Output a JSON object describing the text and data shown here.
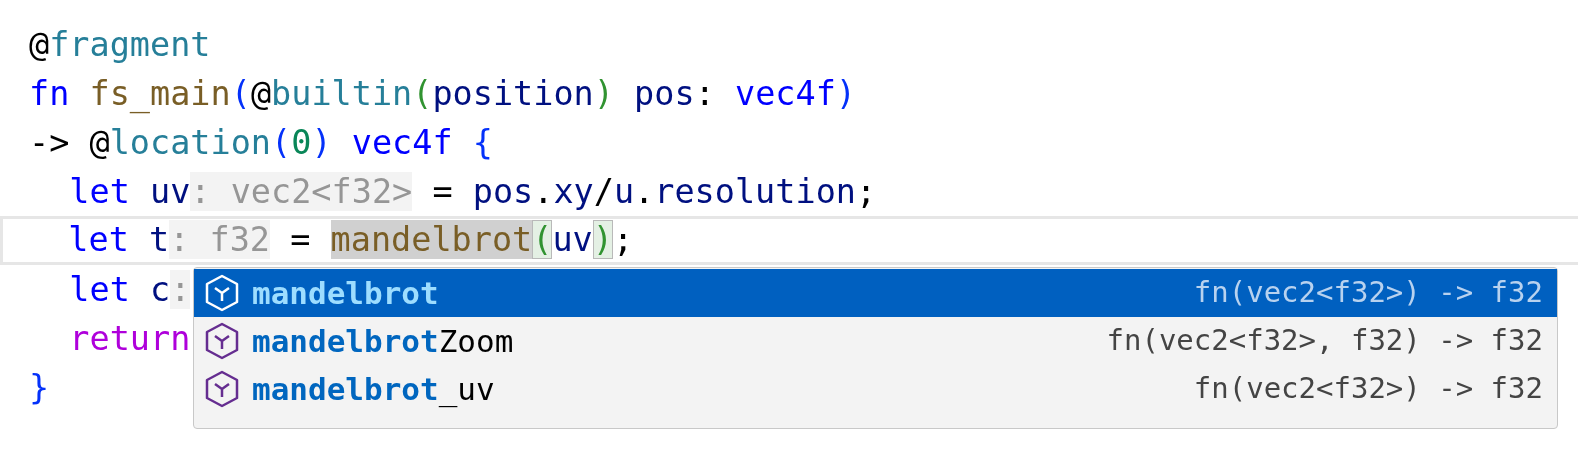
{
  "editor": {
    "lines": [
      {
        "current": false,
        "tokens": [
          {
            "text": "@",
            "kind": "plain"
          },
          {
            "text": "fragment",
            "kind": "attribute"
          }
        ]
      },
      {
        "current": false,
        "tokens": [
          {
            "text": "fn ",
            "kind": "keyword"
          },
          {
            "text": "fs_main",
            "kind": "function"
          },
          {
            "text": "(",
            "kind": "paren"
          },
          {
            "text": "@",
            "kind": "plain"
          },
          {
            "text": "builtin",
            "kind": "attribute"
          },
          {
            "text": "(",
            "kind": "paren2"
          },
          {
            "text": "position",
            "kind": "variable"
          },
          {
            "text": ") ",
            "kind": "paren2"
          },
          {
            "text": "pos",
            "kind": "variable"
          },
          {
            "text": ": ",
            "kind": "plain"
          },
          {
            "text": "vec4f",
            "kind": "type"
          },
          {
            "text": ")",
            "kind": "paren"
          }
        ]
      },
      {
        "current": false,
        "tokens": [
          {
            "text": "-> @",
            "kind": "plain"
          },
          {
            "text": "location",
            "kind": "attribute"
          },
          {
            "text": "(",
            "kind": "paren"
          },
          {
            "text": "0",
            "kind": "number"
          },
          {
            "text": ") ",
            "kind": "paren"
          },
          {
            "text": "vec4f ",
            "kind": "type"
          },
          {
            "text": "{",
            "kind": "paren"
          }
        ]
      },
      {
        "current": false,
        "tokens": [
          {
            "text": "  let ",
            "kind": "keyword"
          },
          {
            "text": "uv",
            "kind": "variable"
          },
          {
            "text": ": vec2<f32>",
            "kind": "hint"
          },
          {
            "text": " = ",
            "kind": "plain"
          },
          {
            "text": "pos",
            "kind": "variable"
          },
          {
            "text": ".",
            "kind": "plain"
          },
          {
            "text": "xy",
            "kind": "variable"
          },
          {
            "text": "/",
            "kind": "plain"
          },
          {
            "text": "u",
            "kind": "variable"
          },
          {
            "text": ".",
            "kind": "plain"
          },
          {
            "text": "resolution",
            "kind": "variable"
          },
          {
            "text": ";",
            "kind": "plain"
          }
        ]
      },
      {
        "current": true,
        "tokens": [
          {
            "text": "  let ",
            "kind": "keyword"
          },
          {
            "text": "t",
            "kind": "variable"
          },
          {
            "text": ": f32",
            "kind": "hint"
          },
          {
            "text": " = ",
            "kind": "plain"
          },
          {
            "text": "mandelbrot",
            "kind": "function",
            "highlighted": true
          },
          {
            "text": "(",
            "kind": "paren2",
            "matched": true
          },
          {
            "text": "uv",
            "kind": "variable"
          },
          {
            "text": ")",
            "kind": "paren2",
            "matched": true
          },
          {
            "text": ";",
            "kind": "plain"
          }
        ]
      },
      {
        "current": false,
        "tokens": [
          {
            "text": "  let ",
            "kind": "keyword"
          },
          {
            "text": "c",
            "kind": "variable"
          },
          {
            "text": ":",
            "kind": "hint"
          }
        ]
      },
      {
        "current": false,
        "tokens": [
          {
            "text": "  return",
            "kind": "control"
          }
        ]
      },
      {
        "current": false,
        "tokens": [
          {
            "text": "}",
            "kind": "paren"
          }
        ]
      }
    ]
  },
  "suggestions": [
    {
      "match": "mandelbrot",
      "detail": "fn(vec2<f32>) -> f32",
      "selected": true
    },
    {
      "match": "mandelbrot",
      "rest": "Zoom",
      "detail": "fn(vec2<f32>, f32) -> f32",
      "selected": false
    },
    {
      "match": "mandelbrot",
      "rest": "_uv",
      "detail": "fn(vec2<f32>) -> f32",
      "selected": false
    }
  ]
}
